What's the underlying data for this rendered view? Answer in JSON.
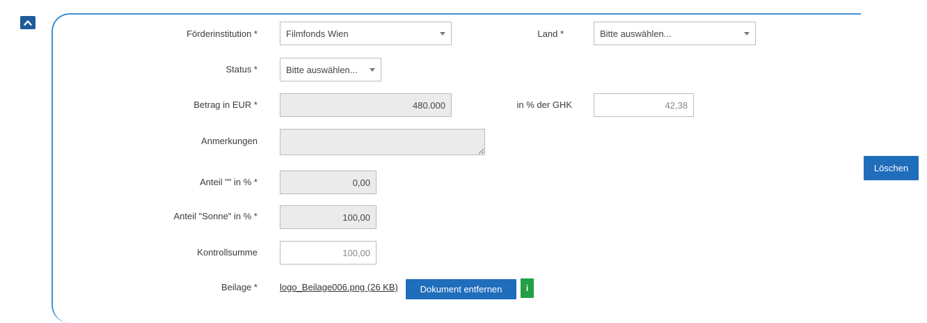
{
  "labels": {
    "foerderinstitution": "Förderinstitution *",
    "land": "Land *",
    "status": "Status *",
    "betrag": "Betrag in EUR *",
    "prozent_ghk": "in % der GHK",
    "anmerkungen": "Anmerkungen",
    "anteil_leer": "Anteil \"\" in % *",
    "anteil_sonne": "Anteil \"Sonne\" in % *",
    "kontrollsumme": "Kontrollsumme",
    "beilage": "Beilage *"
  },
  "fields": {
    "foerderinstitution": "Filmfonds Wien",
    "land": "Bitte auswählen...",
    "status": "Bitte auswählen...",
    "betrag": "480.000",
    "prozent_ghk": "42,38",
    "anmerkungen": "",
    "anteil_leer": "0,00",
    "anteil_sonne": "100,00",
    "kontrollsumme": "100,00"
  },
  "attachment": {
    "file_link": "logo_Beilage006.png (26 KB)",
    "remove_label": "Dokument entfernen",
    "info_label": "i"
  },
  "actions": {
    "delete_label": "Löschen"
  },
  "colors": {
    "accent": "#1f6dbb",
    "frame": "#3f8fd2",
    "info": "#23a046",
    "readonly_bg": "#ebebeb"
  },
  "icons": {
    "collapse": "chevron-up-icon"
  }
}
